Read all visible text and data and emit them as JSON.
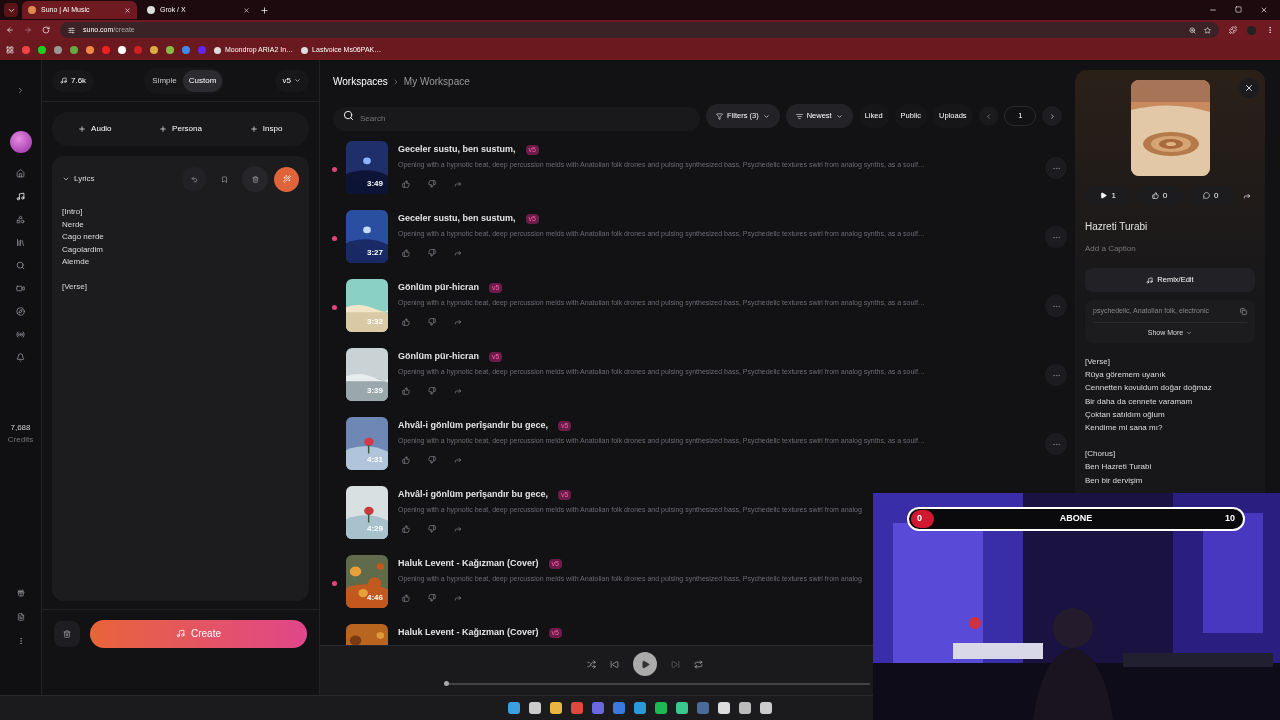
{
  "browser": {
    "tabs": [
      {
        "title": "Suno | AI Music",
        "selected": true
      },
      {
        "title": "Grok / X",
        "selected": false
      }
    ],
    "url_host": "suno.com",
    "url_path": "/create",
    "bookmarks": [
      "Moondrop ARIA2 In…",
      "Lastvoice Ms06PAK…"
    ]
  },
  "rail": {
    "credits": "7,688",
    "credits_label": "Credits"
  },
  "create_panel": {
    "credit_badge": "7.6k",
    "modes": [
      {
        "label": "Simple",
        "selected": false
      },
      {
        "label": "Custom",
        "selected": true
      }
    ],
    "model": "v5",
    "add_buttons": [
      "Audio",
      "Persona",
      "Inspo"
    ],
    "lyrics": {
      "title": "Lyrics",
      "expanded": true,
      "stanzas": [
        [
          "[Intro]",
          "Nerde",
          "Cago nerde",
          "Cagolardim",
          "Alemde"
        ],
        [
          "[Verse]"
        ]
      ]
    },
    "create_button": "Create"
  },
  "workspace": {
    "breadcrumb": [
      "Workspaces",
      "My Workspace"
    ],
    "search": {
      "placeholder": "Search"
    },
    "filters": "Filters (3)",
    "sort": "Newest",
    "chips": [
      "Liked",
      "Public",
      "Uploads"
    ],
    "page": "1",
    "songs": [
      {
        "title": "Geceler sustu, ben sustum,",
        "badge": "v5",
        "duration": "3:49",
        "new": true,
        "menu": true,
        "description": "Opening with a hypnotic beat, deep percussion melds with Anatolian folk drones and pulsing synthesized bass, Psychedelic textures swirl from analog synths, as a soulf…"
      },
      {
        "title": "Geceler sustu, ben sustum,",
        "badge": "v5",
        "duration": "3:27",
        "new": true,
        "menu": true,
        "description": "Opening with a hypnotic beat, deep percussion melds with Anatolian folk drones and pulsing synthesized bass, Psychedelic textures swirl from analog synths, as a soulf…"
      },
      {
        "title": "Gönlüm pür-hicran",
        "badge": "v5",
        "duration": "3:32",
        "new": true,
        "menu": true,
        "description": "Opening with a hypnotic beat, deep percussion melds with Anatolian folk drones and pulsing synthesized bass, Psychedelic textures swirl from analog synths, as a soulf…"
      },
      {
        "title": "Gönlüm pür-hicran",
        "badge": "v5",
        "duration": "3:39",
        "new": false,
        "menu": true,
        "description": "Opening with a hypnotic beat, deep percussion melds with Anatolian folk drones and pulsing synthesized bass, Psychedelic textures swirl from analog synths, as a soulf…"
      },
      {
        "title": "Ahvâl-i gönlüm perîşandır bu gece,",
        "badge": "v5",
        "duration": "4:31",
        "new": false,
        "menu": true,
        "description": "Opening with a hypnotic beat, deep percussion melds with Anatolian folk drones and pulsing synthesized bass, Psychedelic textures swirl from analog synths, as a soulf…"
      },
      {
        "title": "Ahvâl-i gönlüm perîşandır bu gece,",
        "badge": "v5",
        "duration": "4:29",
        "new": false,
        "menu": false,
        "description": "Opening with a hypnotic beat, deep percussion melds with Anatolian folk drones and pulsing synthesized bass, Psychedelic textures swirl from analog"
      },
      {
        "title": "Haluk Levent - Kağızman (Cover)",
        "badge": "v5",
        "duration": "4:46",
        "new": true,
        "menu": false,
        "description": "Opening with a hypnotic beat, deep percussion melds with Anatolian folk drones and pulsing synthesized bass, Psychedelic textures swirl from analog"
      },
      {
        "title": "Haluk Levent - Kağızman (Cover)",
        "badge": "v5",
        "new": false,
        "menu": false
      }
    ]
  },
  "song_detail": {
    "plays": "1",
    "likes": "0",
    "comments": "0",
    "title": "Hazreti Turabi",
    "caption": {
      "placeholder": "Add a Caption"
    },
    "remix_button": "Remix/Edit",
    "tags": "psychedelic, Anatolian folk, electronic",
    "show_more": "Show More",
    "lyrics": [
      [
        "[Verse]",
        "Rüya göremem uyanık",
        "Cennetten kovuldum doğar doğmaz",
        "Bir daha da cennete varamam",
        "Çoktan satıldım oğlum",
        "Kendime mi sana mı?"
      ],
      [
        "[Chorus]",
        "Ben Hazreti Turabi",
        "Ben bir dervişim"
      ]
    ]
  },
  "player": {
    "level": 0
  },
  "stream_overlay": {
    "label": "ABONE",
    "current": "0",
    "target": "10",
    "level": 0
  }
}
